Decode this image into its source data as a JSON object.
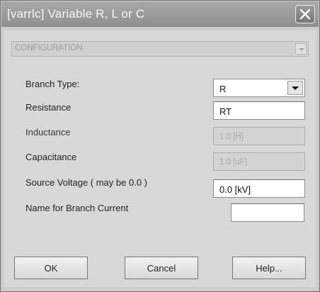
{
  "window": {
    "title": "[varrlc] Variable R, L or C"
  },
  "config": {
    "value": "CONFIGURATION"
  },
  "rows": {
    "branch_type": {
      "label": "Branch Type:",
      "value": "R"
    },
    "resistance": {
      "label": "Resistance",
      "value": "RT"
    },
    "inductance": {
      "label": "Inductance",
      "value": "1.0 [H]"
    },
    "capacitance": {
      "label": "Capacitance",
      "value": "1.0 [uF]"
    },
    "source_voltage": {
      "label": "Source Voltage ( may be 0.0 )",
      "value": "0.0 [kV]"
    },
    "name_branch_current": {
      "label": "Name for Branch Current",
      "value": ""
    }
  },
  "buttons": {
    "ok": "OK",
    "cancel": "Cancel",
    "help": "Help..."
  },
  "icons": {
    "close": "close-icon",
    "dropdown": "chevron-down-icon"
  },
  "colors": {
    "titlebar": "#8f8f8f",
    "window_bg": "#d8d8d8",
    "disabled_text": "#a9a9a9"
  }
}
